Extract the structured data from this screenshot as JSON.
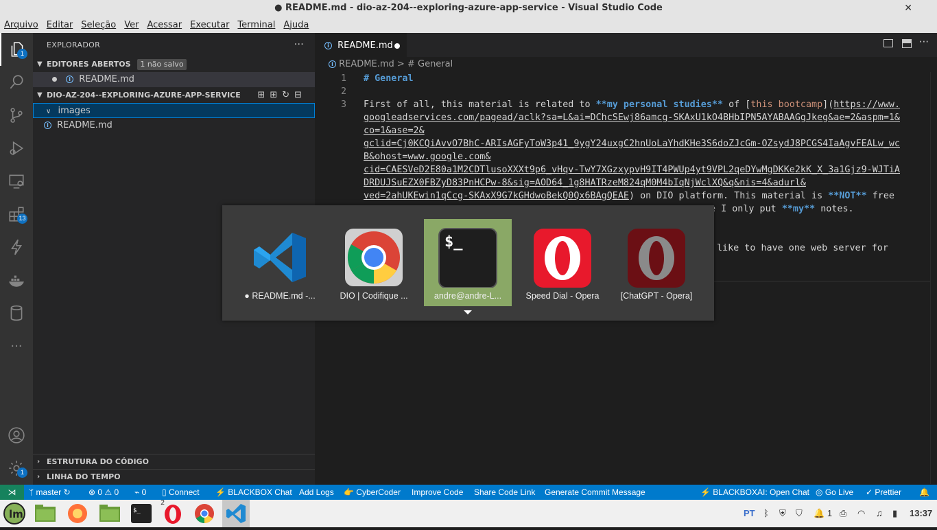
{
  "window": {
    "title": "● README.md - dio-az-204--exploring-azure-app-service - Visual Studio Code",
    "close": "✕"
  },
  "menu": [
    "Arquivo",
    "Editar",
    "Seleção",
    "Ver",
    "Acessar",
    "Executar",
    "Terminal",
    "Ajuda"
  ],
  "activity": {
    "explorer_badge": "1",
    "extensions_badge": "13",
    "manage_badge": "1"
  },
  "sidebar": {
    "title": "EXPLORADOR",
    "more": "···",
    "open_editors": {
      "header": "EDITORES ABERTOS",
      "unsaved": "1 não salvo",
      "file": "README.md"
    },
    "project": {
      "header": "DIO-AZ-204--EXPLORING-AZURE-APP-SERVICE",
      "folder": "images",
      "file": "README.md"
    },
    "outline": "ESTRUTURA DO CÓDIGO",
    "timeline": "LINHA DO TEMPO"
  },
  "editor": {
    "tab": "README.md",
    "breadcrumb": {
      "file": "README.md",
      "sep": ">",
      "section": "# General"
    },
    "line_numbers": [
      "1",
      "2",
      "3"
    ],
    "line1": "# General",
    "line3": {
      "prefix": "First of all, this material is related to ",
      "bold": "**my personal studies**",
      "mid": " of [",
      "link": "this bootcamp",
      "open": "](",
      "url": [
        "https://www.",
        "googleadservices.com/pagead/aclk?sa=L&ai=DChcSEwj86amcg-SKAxU1kO4BHbIPN5AYABAAGgJkeg&ae=2&aspm=1&",
        "co=1&ase=2&",
        "gclid=Cj0KCQiAvvO7BhC-ARIsAGFyToW3p41_9ygY24uxgC2hnUoLaYhdKHe3S6doZJcGm-OZsydJ8PCGS4IaAgvFEALw_wc",
        "B&ohost=www.google.com&",
        "cid=CAESVeD2E80a1M2CDTlusoXXXt9p6_vHqv-TwY7XGzxypvH9IT4PWUp4yt9VPL2qeDYwMgDKKe2kK_X_3a1Gjz9-WJTiA",
        "DRDUJSuEZX0FBZyD83PnHCPw-8&sig=AOD64_1g8HATRzeM824qM0M4bIqNjWclXQ&q&nis=4&adurl&",
        "ved=2ahUKEwin1qCcg-SKAxX9G7kGHdwoBekQ0Qx6BAgQEAE"
      ],
      "after": ") on DIO platform. This material is ",
      "not": "**NOT**",
      "free": " free",
      "l9_a": "e I only put ",
      "l9_b": "**my**",
      "l9_c": " notes.",
      "l11": "like to have one web server for"
    }
  },
  "switcher": [
    {
      "label": "● README.md -...",
      "icon": "vscode-icon"
    },
    {
      "label": "DIO | Codifique ...",
      "icon": "chrome-icon"
    },
    {
      "label": "andre@andre-L...",
      "icon": "terminal-icon",
      "selected": true
    },
    {
      "label": "Speed Dial - Opera",
      "icon": "opera-icon"
    },
    {
      "label": "[ChatGPT - Opera]",
      "icon": "opera-dark-icon"
    }
  ],
  "status": {
    "branch": "master",
    "errors": "0",
    "warnings": "0",
    "ports": "0",
    "connect": "Connect",
    "blackbox_chat": "BLACKBOX Chat",
    "add_logs": "Add Logs",
    "cybercoder": "CyberCoder",
    "improve": "Improve Code",
    "share": "Share Code Link",
    "commit": "Generate Commit Message",
    "open_chat": "BLACKBOXAI: Open Chat",
    "go_live": "Go Live",
    "prettier": "Prettier"
  },
  "taskbar": {
    "opera_badge": "2",
    "lang": "PT",
    "notif": "1",
    "clock": "13:37"
  }
}
